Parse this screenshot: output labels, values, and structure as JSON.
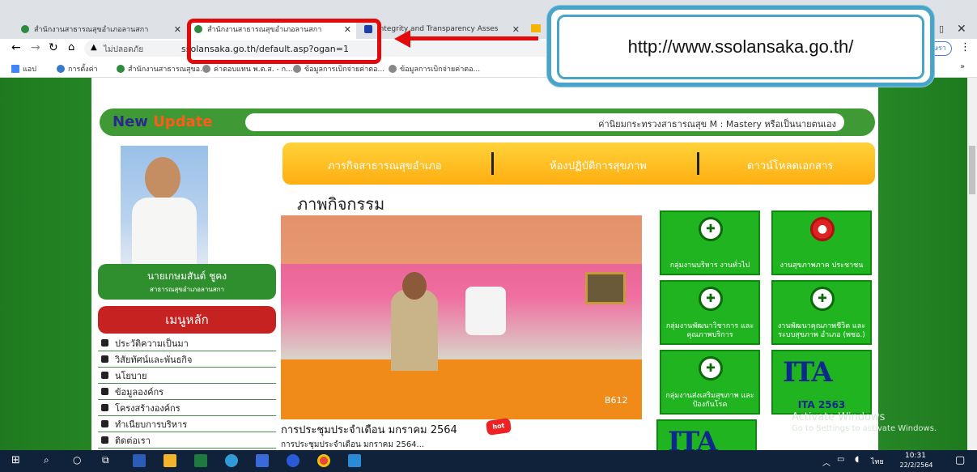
{
  "browser": {
    "tabs": [
      {
        "label": "สำนักงานสาธารณสุขอำเภอลานสกา"
      },
      {
        "label": "สำนักงานสาธารณสุขอำเภอลานสกา"
      },
      {
        "label": "Integrity and Transparency Asses"
      }
    ],
    "address": {
      "security": "ไม่ปลอดภัย",
      "url": "ssolansaka.go.th/default.asp?ogan=1"
    },
    "bookmarks": [
      {
        "label": "แอป"
      },
      {
        "label": "การตั้งค่า"
      },
      {
        "label": "สำนักงานสาธารณสุขอ..."
      },
      {
        "label": "ค่าตอบแทน พ.ต.ส. - ก..."
      },
      {
        "label": "ข้อมูลการเบิกจ่ายค่าตอ..."
      },
      {
        "label": "ข้อมูลการเบิกจ่ายค่าตอ..."
      }
    ],
    "profile_label": "ษรา"
  },
  "annotation": {
    "callout_text": "http://www.ssolansaka.go.th/",
    "accent": "#e20a0a",
    "callout_border": "#4aa3c8"
  },
  "site": {
    "new_update_1": "New",
    "new_update_2": "Update",
    "marquee": "ค่านิยมกระทรวงสาธารณสุข M : Mastery หรือเป็นนายตนเอง",
    "nav": [
      "ภารกิจสาธารณสุขอำเภอ",
      "ห้องปฏิบัติการสุขภาพ",
      "ดาวน์โหลดเอกสาร"
    ],
    "person_name": "นายเกษมสันต์ ชูคง",
    "person_title": "สาธารณสุขอำเภอลานสกา",
    "menu_title": "เมนูหลัก",
    "menu_items": [
      "ประวัติความเป็นมา",
      "วิสัยทัศน์และพันธกิจ",
      "นโยบาย",
      "ข้อมูลองค์กร",
      "โครงสร้างองค์กร",
      "ทำเนียบการบริหาร",
      "ติดต่อเรา"
    ],
    "activity_title": "ภาพกิจกรรม",
    "caption": "การประชุมประจำเดือน มกราคม 2564",
    "hot_badge": "hot",
    "subcaption": "การประชุมประจำเดือน มกราคม 2564...",
    "photo_stamp": "B612",
    "tiles": [
      {
        "label": "กลุ่มงานบริหาร งานทั่วไป"
      },
      {
        "label": "งานสุขภาพภาค ประชาชน"
      },
      {
        "label": "กลุ่มงานพัฒนาวิชาการ และคุณภาพบริการ"
      },
      {
        "label": "งานพัฒนาคุณภาพชีวิต และระบบสุขภาพ อำเภอ (พชอ.)"
      },
      {
        "label": "กลุ่มงานส่งเสริมสุขภาพ และป้องกันโรค"
      },
      {
        "label": "ITA 2563"
      }
    ],
    "ita_logo": "ITA"
  },
  "windows": {
    "watermark_title": "Activate Windows",
    "watermark_sub": "Go to Settings to activate Windows.",
    "clock_time": "10:31",
    "clock_date": "22/2/2564",
    "lang": "ไทย"
  }
}
